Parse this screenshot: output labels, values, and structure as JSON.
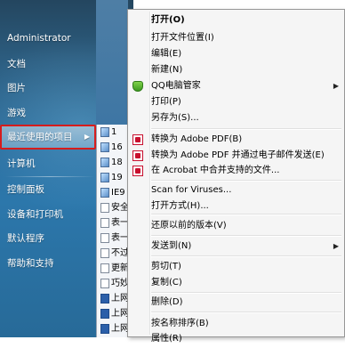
{
  "start_menu": {
    "items": [
      {
        "label": "Administrator"
      },
      {
        "label": "文档"
      },
      {
        "label": "图片"
      },
      {
        "label": "游戏"
      },
      {
        "label": "最近使用的项目",
        "arrow": "▶"
      },
      {
        "label": "计算机"
      },
      {
        "label": "控制面板"
      },
      {
        "label": "设备和打印机"
      },
      {
        "label": "默认程序"
      },
      {
        "label": "帮助和支持"
      }
    ]
  },
  "recent_items": [
    {
      "label": "1",
      "icon": "image-icon"
    },
    {
      "label": "16",
      "icon": "image-icon"
    },
    {
      "label": "18",
      "icon": "image-icon"
    },
    {
      "label": "19",
      "icon": "image-icon"
    },
    {
      "label": "IE9",
      "icon": "image-icon"
    },
    {
      "label": "安全",
      "icon": "document-icon"
    },
    {
      "label": "表一",
      "icon": "document-icon"
    },
    {
      "label": "表一",
      "icon": "document-icon"
    },
    {
      "label": "不过",
      "icon": "document-icon"
    },
    {
      "label": "更新",
      "icon": "document-icon"
    },
    {
      "label": "巧妙",
      "icon": "document-icon"
    },
    {
      "label": "上网",
      "icon": "word-icon"
    },
    {
      "label": "上网",
      "icon": "word-icon"
    },
    {
      "label": "上网",
      "icon": "word-icon"
    },
    {
      "label": "上网",
      "icon": "word-icon"
    }
  ],
  "context_menu": {
    "items": [
      {
        "label": "打开(O)",
        "bold": true
      },
      {
        "label": "打开文件位置(I)"
      },
      {
        "label": "编辑(E)"
      },
      {
        "label": "新建(N)"
      },
      {
        "label": "QQ电脑管家",
        "icon": "qq-shield-icon",
        "submenu": "▶"
      },
      {
        "label": "打印(P)"
      },
      {
        "label": "另存为(S)..."
      },
      {
        "label": "转换为 Adobe PDF(B)",
        "icon": "pdf-icon"
      },
      {
        "label": "转换为 Adobe PDF 并通过电子邮件发送(E)",
        "icon": "pdf-icon"
      },
      {
        "label": "在 Acrobat 中合并支持的文件...",
        "icon": "pdf-icon"
      },
      {
        "label": "Scan for Viruses..."
      },
      {
        "label": "打开方式(H)..."
      },
      {
        "label": "还原以前的版本(V)"
      },
      {
        "label": "发送到(N)",
        "submenu": "▶"
      },
      {
        "label": "剪切(T)"
      },
      {
        "label": "复制(C)"
      },
      {
        "label": "删除(D)"
      },
      {
        "label": "按名称排序(B)"
      },
      {
        "label": "属性(R)"
      }
    ]
  },
  "colors": {
    "highlight_border": "#d61c1c",
    "menu_bg": "#f5f5f5",
    "start_panel_top": "#24465f",
    "start_panel_mid": "#2b6fa0"
  }
}
